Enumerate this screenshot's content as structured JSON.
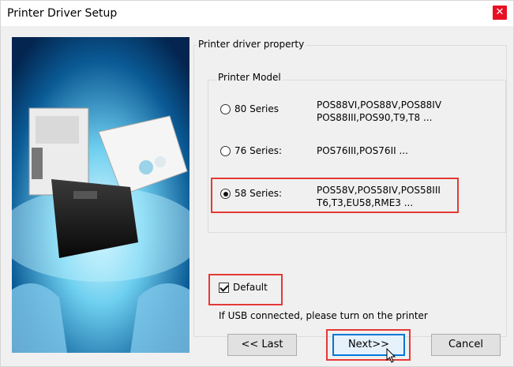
{
  "window": {
    "title": "Printer Driver Setup",
    "close_glyph": "✕"
  },
  "property_group": {
    "label": "Printer driver property"
  },
  "model_group": {
    "label": "Printer Model"
  },
  "series": [
    {
      "label": "80 Series",
      "models_line1": "POS88VI,POS88V,POS88IV",
      "models_line2": "POS88III,POS90,T9,T8 ...",
      "checked": false
    },
    {
      "label": "76 Series:",
      "models_line1": "POS76III,POS76II ...",
      "models_line2": "",
      "checked": false
    },
    {
      "label": "58 Series:",
      "models_line1": "POS58V,POS58IV,POS58III",
      "models_line2": "T6,T3,EU58,RME3 ...",
      "checked": true
    }
  ],
  "default_checkbox": {
    "label": "Default",
    "checked": true
  },
  "note": "If USB connected, please turn on the printer",
  "buttons": {
    "back": "<< Last",
    "next": "Next>>",
    "cancel": "Cancel"
  },
  "colors": {
    "highlight": "#e53935",
    "close": "#e81123",
    "focus": "#0078d7"
  },
  "icons": {
    "close": "close-icon",
    "cursor": "mouse-pointer-icon"
  }
}
